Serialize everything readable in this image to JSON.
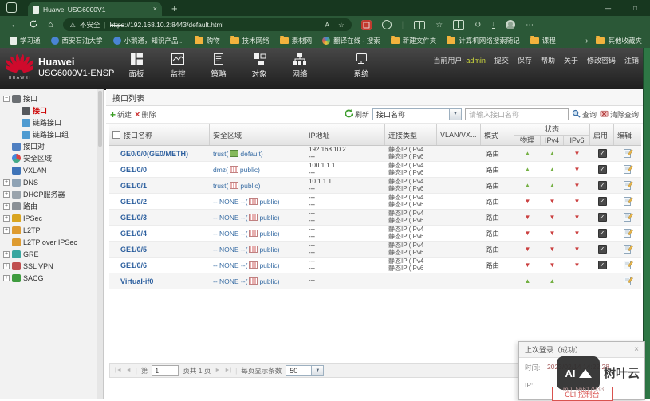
{
  "icons": {
    "warning": "⚠",
    "back": "←",
    "home": "⌂",
    "new_tab": "+",
    "close": "×",
    "minimize": "—",
    "maximize": "□",
    "star": "☆",
    "star_add": "☆",
    "more": "⋯",
    "history": "↺",
    "read_aloud": "A",
    "overflow": "›",
    "first": "|◄",
    "prev": "◄",
    "next": "►",
    "last": "►|",
    "dropdown": "▼",
    "up_arrow": "▲",
    "down_arrow": "▼",
    "check": "✓"
  },
  "colors": {
    "brand_red": "#cf0a2c",
    "accent_green": "#74b043",
    "accent_red": "#cb4040",
    "link_blue": "#2c5f9e",
    "chrome_green": "#2b5837",
    "selected_item_red": "#c00000"
  },
  "browser": {
    "tab_title": "Huawei USG6000V1",
    "security_label": "不安全",
    "url_scheme": "https",
    "url_rest": "://192.168.10.2:8443/default.html",
    "bookmarks": [
      {
        "label": "学习通",
        "icon": "page"
      },
      {
        "label": "西安石油大学",
        "icon": "site-blue"
      },
      {
        "label": "小鹅通，知识产品...",
        "icon": "site-blue"
      },
      {
        "label": "购物",
        "icon": "folder"
      },
      {
        "label": "技术网络",
        "icon": "folder"
      },
      {
        "label": "素材网",
        "icon": "folder"
      },
      {
        "label": "翻译在线 - 搜索",
        "icon": "site-multi"
      },
      {
        "label": "新建文件夹",
        "icon": "folder"
      },
      {
        "label": "计算机网络搜索随记",
        "icon": "folder"
      },
      {
        "label": "课程",
        "icon": "folder"
      }
    ],
    "other_bookmarks": "其他收藏夹"
  },
  "app_header": {
    "brand_mark": "HUAWEI",
    "brand_line1": "Huawei",
    "brand_line2": "USG6000V1-ENSP",
    "nav": [
      {
        "label": "面板",
        "icon": "dashboard"
      },
      {
        "label": "监控",
        "icon": "monitor"
      },
      {
        "label": "策略",
        "icon": "policy"
      },
      {
        "label": "对象",
        "icon": "object"
      },
      {
        "label": "网络",
        "icon": "network"
      },
      {
        "label": "系统",
        "icon": "system"
      }
    ],
    "user_prefix": "当前用户:",
    "user": "admin",
    "actions": [
      "提交",
      "保存",
      "帮助",
      "关于",
      "修改密码",
      "注销"
    ]
  },
  "sidebar": {
    "items": [
      {
        "label": "接口",
        "level": 0,
        "expander": "−",
        "icon_color": "#6b6f73"
      },
      {
        "label": "接口",
        "level": 1,
        "selected": true,
        "icon_color": "#55585c"
      },
      {
        "label": "链路接口",
        "level": 1,
        "icon_color": "#4f9bd1"
      },
      {
        "label": "链路接口组",
        "level": 1,
        "icon_color": "#4f9bd1"
      },
      {
        "label": "接口对",
        "level": 0,
        "icon_color": "#4f7fc1"
      },
      {
        "label": "安全区域",
        "level": 0,
        "icon_type": "pie"
      },
      {
        "label": "VXLAN",
        "level": 0,
        "icon_color": "#3f74b8"
      },
      {
        "label": "DNS",
        "level": 0,
        "expander": "+",
        "icon_color": "#8fa3b5"
      },
      {
        "label": "DHCP服务器",
        "level": 0,
        "expander": "+",
        "icon_color": "#9aa4ad"
      },
      {
        "label": "路由",
        "level": 0,
        "expander": "+",
        "icon_color": "#8a9096"
      },
      {
        "label": "IPSec",
        "level": 0,
        "expander": "+",
        "icon_color": "#d9a521"
      },
      {
        "label": "L2TP",
        "level": 0,
        "expander": "+",
        "icon_color": "#de9b30"
      },
      {
        "label": "L2TP over IPSec",
        "level": 0,
        "icon_color": "#de9b30"
      },
      {
        "label": "GRE",
        "level": 0,
        "expander": "+",
        "icon_color": "#3aa7a0"
      },
      {
        "label": "SSL VPN",
        "level": 0,
        "expander": "+",
        "icon_color": "#c05050"
      },
      {
        "label": "SACG",
        "level": 0,
        "expander": "+",
        "icon_color": "#3f9c3f"
      }
    ]
  },
  "main": {
    "title": "接口列表",
    "toolbar": {
      "new_label": "新建",
      "delete_label": "删除",
      "refresh_label": "刷新",
      "filter_selected": "接口名称",
      "search_placeholder": "请输入接口名称",
      "query_label": "查询",
      "clear_label": "清除查询"
    },
    "table": {
      "headers": {
        "name": "接口名称",
        "zone": "安全区域",
        "ip": "IP地址",
        "conn": "连接类型",
        "vlan": "VLAN/VX...",
        "mode": "模式",
        "status": "状态",
        "phys": "物理",
        "ipv4": "IPv4",
        "ipv6": "IPv6",
        "enable": "启用",
        "edit": "编辑"
      },
      "rows": [
        {
          "name": "GE0/0/0(GE0/METH)",
          "zone_pre": "trust(",
          "zone_suf": "default)",
          "zone_icon": "green",
          "ip": [
            "192.168.10.2",
            "---"
          ],
          "conn": [
            "静态IP (IPv4",
            "静态IP (IPv6"
          ],
          "vlan": "",
          "mode": "路由",
          "status": [
            "up",
            "up",
            "down"
          ],
          "enabled": true
        },
        {
          "name": "GE1/0/0",
          "zone_pre": "dmz(",
          "zone_suf": "public)",
          "zone_icon": "pink",
          "ip": [
            "100.1.1.1",
            "---"
          ],
          "conn": [
            "静态IP (IPv4",
            "静态IP (IPv6"
          ],
          "vlan": "",
          "mode": "路由",
          "status": [
            "up",
            "up",
            "down"
          ],
          "enabled": true
        },
        {
          "name": "GE1/0/1",
          "zone_pre": "trust(",
          "zone_suf": "public)",
          "zone_icon": "pink",
          "ip": [
            "10.1.1.1",
            "---"
          ],
          "conn": [
            "静态IP (IPv4",
            "静态IP (IPv6"
          ],
          "vlan": "",
          "mode": "路由",
          "status": [
            "up",
            "up",
            "down"
          ],
          "enabled": true
        },
        {
          "name": "GE1/0/2",
          "zone_pre": "-- NONE --(",
          "zone_suf": "public)",
          "zone_icon": "pink",
          "ip": [
            "---",
            "---"
          ],
          "conn": [
            "静态IP (IPv4",
            "静态IP (IPv6"
          ],
          "vlan": "",
          "mode": "路由",
          "status": [
            "down",
            "down",
            "down"
          ],
          "enabled": true
        },
        {
          "name": "GE1/0/3",
          "zone_pre": "-- NONE --(",
          "zone_suf": "public)",
          "zone_icon": "pink",
          "ip": [
            "---",
            "---"
          ],
          "conn": [
            "静态IP (IPv4",
            "静态IP (IPv6"
          ],
          "vlan": "",
          "mode": "路由",
          "status": [
            "down",
            "down",
            "down"
          ],
          "enabled": true
        },
        {
          "name": "GE1/0/4",
          "zone_pre": "-- NONE --(",
          "zone_suf": "public)",
          "zone_icon": "pink",
          "ip": [
            "---",
            "---"
          ],
          "conn": [
            "静态IP (IPv4",
            "静态IP (IPv6"
          ],
          "vlan": "",
          "mode": "路由",
          "status": [
            "down",
            "down",
            "down"
          ],
          "enabled": true
        },
        {
          "name": "GE1/0/5",
          "zone_pre": "-- NONE --(",
          "zone_suf": "public)",
          "zone_icon": "pink",
          "ip": [
            "---",
            "---"
          ],
          "conn": [
            "静态IP (IPv4",
            "静态IP (IPv6"
          ],
          "vlan": "",
          "mode": "路由",
          "status": [
            "down",
            "down",
            "down"
          ],
          "enabled": true
        },
        {
          "name": "GE1/0/6",
          "zone_pre": "-- NONE --(",
          "zone_suf": "public)",
          "zone_icon": "pink",
          "ip": [
            "---",
            "---"
          ],
          "conn": [
            "静态IP (IPv4",
            "静态IP (IPv6"
          ],
          "vlan": "",
          "mode": "路由",
          "status": [
            "down",
            "down",
            "down"
          ],
          "enabled": true
        },
        {
          "name": "Virtual-if0",
          "zone_pre": "-- NONE --(",
          "zone_suf": "public)",
          "zone_icon": "pink",
          "ip": [
            "---"
          ],
          "conn": [],
          "vlan": "",
          "mode": "",
          "status": [
            "up",
            "up",
            ""
          ],
          "enabled": null
        }
      ]
    },
    "pagination": {
      "page_label": "第",
      "page_value": "1",
      "page_total": "页共 1 页",
      "per_page_label": "每页显示条数",
      "per_page_value": "50"
    }
  },
  "popup": {
    "title": "上次登录（成功）",
    "time_label": "时间:",
    "time_value": "2023/02/14 14:22:28",
    "ip_label": "IP:",
    "ip_value": "",
    "cli_button": "CLI 控制台"
  },
  "watermark": {
    "badge_text": "AI",
    "brand": "树叶云",
    "handle": "m0_56617933"
  }
}
